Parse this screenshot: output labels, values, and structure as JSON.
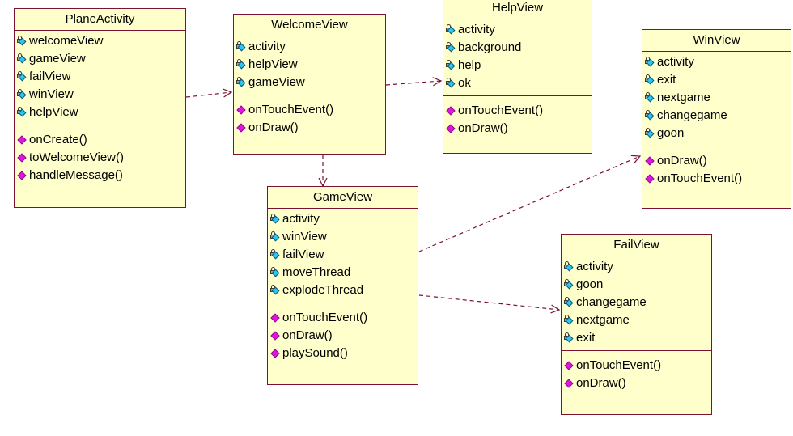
{
  "diagram": {
    "kind": "uml-class-diagram",
    "background_color": "#ffffff",
    "class_fill_color": "#ffffcc",
    "class_border_color": "#7a1230",
    "edge_color": "#7a1230",
    "attribute_icon_color": "#29c7f2",
    "operation_icon_color": "#e016e0",
    "icons": {
      "attribute": "protected-field-icon",
      "operation": "public-method-icon"
    }
  },
  "classes": [
    {
      "id": "planeactivity",
      "name": "PlaneActivity",
      "attributes": [
        "welcomeView",
        "gameView",
        "failView",
        "winView",
        "helpView"
      ],
      "operations": [
        "onCreate()",
        "toWelcomeView()",
        "handleMessage()"
      ]
    },
    {
      "id": "welcomeview",
      "name": "WelcomeView",
      "attributes": [
        "activity",
        "helpView",
        "gameView"
      ],
      "operations": [
        "onTouchEvent()",
        "onDraw()"
      ]
    },
    {
      "id": "helpview",
      "name": "HelpView",
      "attributes": [
        "activity",
        "background",
        "help",
        "ok"
      ],
      "operations": [
        "onTouchEvent()",
        "onDraw()"
      ]
    },
    {
      "id": "winview",
      "name": "WinView",
      "attributes": [
        "activity",
        "exit",
        "nextgame",
        "changegame",
        "goon"
      ],
      "operations": [
        "onDraw()",
        "onTouchEvent()"
      ]
    },
    {
      "id": "gameview",
      "name": "GameView",
      "attributes": [
        "activity",
        "winView",
        "failView",
        "moveThread",
        "explodeThread"
      ],
      "operations": [
        "onTouchEvent()",
        "onDraw()",
        "playSound()"
      ]
    },
    {
      "id": "failview",
      "name": "FailView",
      "attributes": [
        "activity",
        "goon",
        "changegame",
        "nextgame",
        "exit"
      ],
      "operations": [
        "onTouchEvent()",
        "onDraw()"
      ]
    }
  ],
  "relationships": [
    {
      "from": "PlaneActivity",
      "to": "WelcomeView",
      "type": "dependency"
    },
    {
      "from": "WelcomeView",
      "to": "HelpView",
      "type": "dependency"
    },
    {
      "from": "WelcomeView",
      "to": "GameView",
      "type": "dependency"
    },
    {
      "from": "GameView",
      "to": "WinView",
      "type": "dependency"
    },
    {
      "from": "GameView",
      "to": "FailView",
      "type": "dependency"
    }
  ]
}
